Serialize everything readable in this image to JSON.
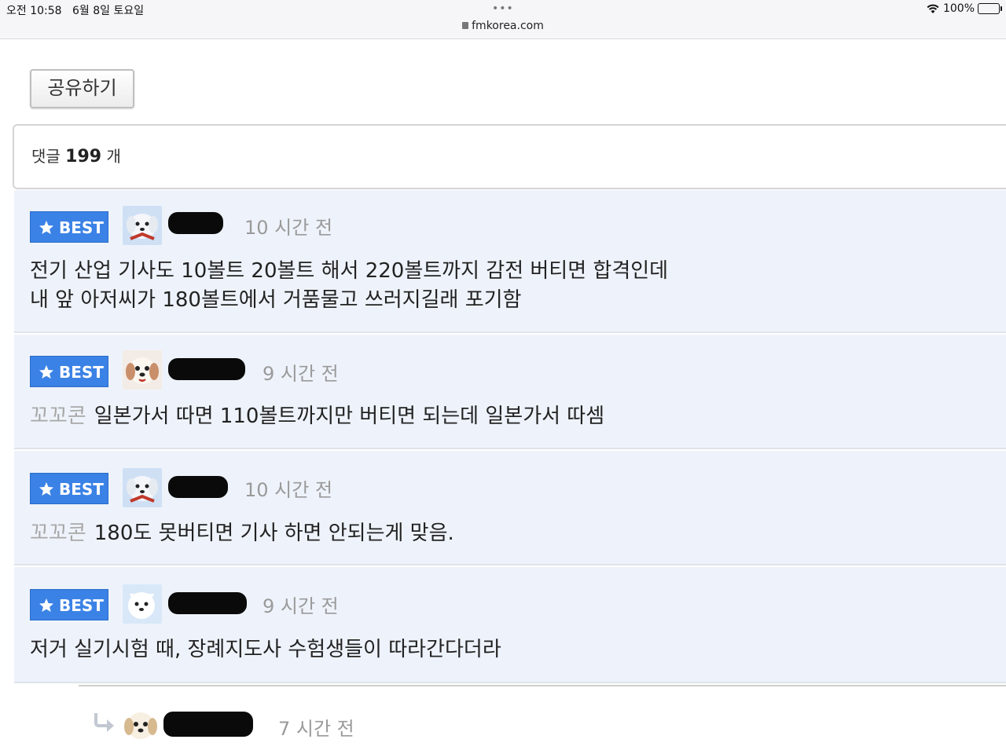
{
  "status_bar": {
    "time": "오전 10:58",
    "date": "6월 8일 토요일",
    "dots": "•••",
    "url": "fmkorea.com",
    "battery": "100%"
  },
  "share_button": {
    "label": "공유하기"
  },
  "comment_count": {
    "prefix": "댓글",
    "count": "199",
    "suffix": "개"
  },
  "comments": [
    {
      "badge": "BEST",
      "time": "10 시간 전",
      "lines": [
        "전기 산업 기사도 10볼트 20볼트 해서 220볼트까지 감전 버티면 합격인데",
        "내 앞 아저씨가 180볼트에서 거품물고 쓰러지길래 포기함"
      ]
    },
    {
      "badge": "BEST",
      "time": "9 시간 전",
      "reply_to": "꼬꼬콘",
      "text": "일본가서 따면 110볼트까지만 버티면 되는데 일본가서 따셈"
    },
    {
      "badge": "BEST",
      "time": "10 시간 전",
      "reply_to": "꼬꼬콘",
      "text": "180도 못버티면 기사 하면 안되는게 맞음."
    },
    {
      "badge": "BEST",
      "time": "9 시간 전",
      "text": "저거 실기시험 때, 장례지도사 수험생들이 따라간다더라"
    }
  ],
  "reply": {
    "time": "7 시간 전"
  },
  "colors": {
    "best_badge": "#3b82e6",
    "comment_bg": "#eef3fb",
    "muted_text": "#9a9a9a"
  },
  "icons": {
    "badge": "star-icon",
    "reply": "reply-arrow-icon",
    "wifi": "wifi-icon",
    "battery": "battery-icon",
    "lock": "lock-icon"
  }
}
